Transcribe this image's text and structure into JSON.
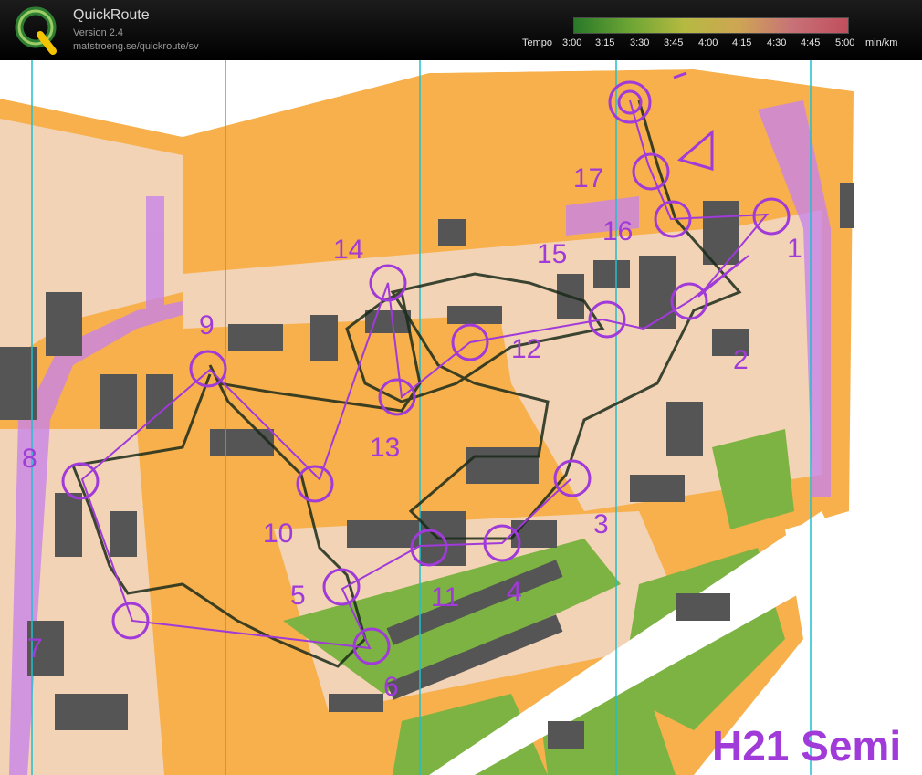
{
  "app": {
    "title": "QuickRoute",
    "version": "Version 2.4",
    "url": "matstroeng.se/quickroute/sv"
  },
  "tempo": {
    "label": "Tempo",
    "ticks": [
      "3:00",
      "3:15",
      "3:30",
      "3:45",
      "4:00",
      "4:15",
      "4:30",
      "4:45",
      "5:00"
    ],
    "unit": "min/km"
  },
  "map": {
    "course_label": "H21 Semi",
    "controls": [
      "1",
      "2",
      "3",
      "4",
      "5",
      "6",
      "7",
      "8",
      "9",
      "10",
      "11",
      "12",
      "13",
      "14",
      "15",
      "16",
      "17"
    ],
    "colors": {
      "open_land": "#f7b04c",
      "paved": "#f3d3b5",
      "building": "#555555",
      "vegetation": "#7cb342",
      "course": "#a03ad8",
      "route": "#1a2a1a",
      "north_lines": "#20c0d0"
    }
  }
}
